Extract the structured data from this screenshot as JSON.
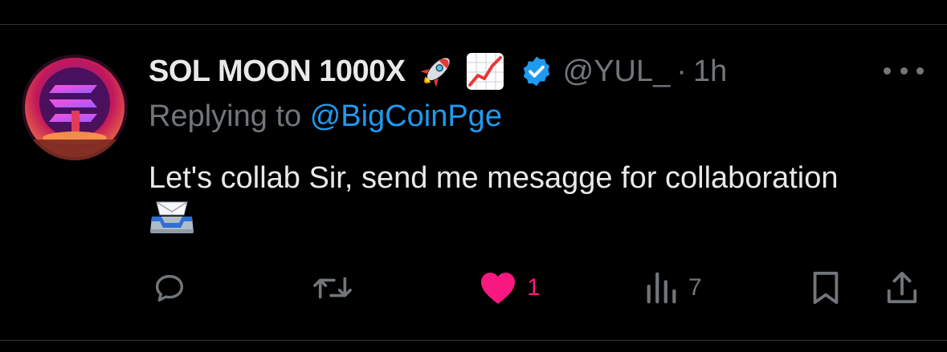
{
  "tweet": {
    "display_name": "SOL MOON 1000X",
    "handle": "@YUL_",
    "separator": "·",
    "time": "1h",
    "reply_prefix": "Replying to",
    "reply_to": "@BigCoinPge",
    "text": "Let's collab Sir, send me mesagge for collaboration",
    "name_emojis": [
      "rocket-icon",
      "chart-increasing-icon"
    ],
    "text_emoji": "inbox-tray-icon",
    "verified_color": "#1d9bf0"
  },
  "actions": {
    "reply_count": "",
    "retweet_count": "",
    "like_count": "1",
    "view_count": "7",
    "like_active": true
  },
  "colors": {
    "background": "#000000",
    "primary_text": "#e7e9ea",
    "secondary_text": "#71767b",
    "link": "#1d9bf0",
    "like": "#f91880",
    "divider": "#2f3336"
  }
}
